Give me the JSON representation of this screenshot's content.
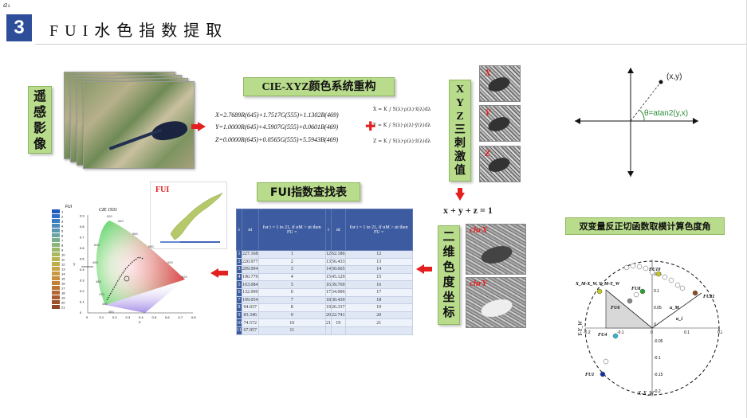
{
  "header": {
    "corner_mark": "a₁",
    "section_number": "3",
    "title": "FUI水色指数提取"
  },
  "labels": {
    "remote_sensing": [
      "遥",
      "感",
      "影",
      "像"
    ],
    "cie": "CIE-XYZ颜色系统重构",
    "xyz": [
      "X",
      "Y",
      "Z",
      "三",
      "刺",
      "激",
      "值"
    ],
    "fui_table": "FUI指数查找表",
    "chroma": [
      "二",
      "维",
      "色",
      "度",
      "坐",
      "标"
    ],
    "atan": "双变量反正切函数取模计算色度角"
  },
  "formulas": [
    "X=2.7689R(645)+1.7517G(555)+1.1302B(469)",
    "Y=1.0000R(645)+4.5907G(555)+0.0601B(469)",
    "Z=0.0000R(645)+0.0565G(555)+5.5943B(469)"
  ],
  "integrals": [
    "X = K ∫ S(λ)·ρ(λ)·x̄(λ)dλ",
    "Y = K ∫ S(λ)·ρ(λ)·ȳ(λ)dλ",
    "Z = K ∫ S(λ)·ρ(λ)·z̄(λ)dλ"
  ],
  "xyz_tags": [
    "X",
    "Y",
    "Z"
  ],
  "chroma_sum": "x + y + z = 1",
  "chroma_tags": [
    "chrX",
    "chrY"
  ],
  "fui_panel_tag": "FUI",
  "lut": {
    "headers": [
      "i",
      "αi",
      "for i = 1 to 21, if αM > αi then FU =",
      "i",
      "αi",
      "for i = 1 to 21, if αM > αi then FU ="
    ],
    "rows": [
      [
        "1",
        "227.168",
        "1",
        "12",
        "62.186",
        "12"
      ],
      [
        "2",
        "220.977",
        "2",
        "13",
        "56.433",
        "13"
      ],
      [
        "3",
        "209.994",
        "3",
        "14",
        "50.665",
        "14"
      ],
      [
        "4",
        "190.779",
        "4",
        "15",
        "45.129",
        "15"
      ],
      [
        "5",
        "163.084",
        "5",
        "16",
        "39.769",
        "16"
      ],
      [
        "6",
        "132.999",
        "6",
        "17",
        "34.906",
        "17"
      ],
      [
        "7",
        "109.054",
        "7",
        "18",
        "30.439",
        "18"
      ],
      [
        "8",
        "94.037",
        "8",
        "19",
        "26.337",
        "19"
      ],
      [
        "9",
        "83.346",
        "9",
        "20",
        "22.741",
        "20"
      ],
      [
        "10",
        "74.572",
        "10",
        "21",
        "19",
        "21"
      ],
      [
        "11",
        "67.957",
        "11",
        "",
        "",
        ""
      ]
    ]
  },
  "cie": {
    "title": "CIE 1931",
    "legend_title": "FUI",
    "fui_colors": [
      "#2158bc",
      "#316dc5",
      "#3b7bc1",
      "#4a8aba",
      "#5a98b0",
      "#6aa5a0",
      "#7aae8c",
      "#8ab47a",
      "#9ab86a",
      "#a8b85c",
      "#b4b452",
      "#bdae4c",
      "#c4a546",
      "#c69a42",
      "#c68e3e",
      "#c2813a",
      "#bc7436",
      "#b36732",
      "#a85b2e",
      "#9c512b",
      "#8e4828"
    ],
    "legend_labels": [
      "1",
      "2",
      "3",
      "4",
      "5",
      "6",
      "7",
      "8",
      "9",
      "10",
      "11",
      "12",
      "13",
      "14",
      "15",
      "16",
      "17",
      "18",
      "19",
      "20",
      "21"
    ],
    "x_ticks": [
      "0",
      "0.1",
      "0.2",
      "0.3",
      "0.4",
      "0.5",
      "0.6",
      "0.7",
      "0.8"
    ],
    "y_ticks": [
      "0",
      "0.1",
      "0.2",
      "0.3",
      "0.4",
      "0.5",
      "0.6",
      "0.7",
      "0.8",
      "0.9"
    ],
    "wavelength_labels": [
      "520",
      "540",
      "560",
      "580",
      "600",
      "620",
      "500",
      "490",
      "480",
      "470",
      "460",
      "380"
    ],
    "xlabel": "x",
    "ylabel": "y"
  },
  "polar": {
    "point_label": "(x,y)",
    "angle_label": "θ=atan2(y,x)"
  },
  "hue": {
    "x_ticks": [
      "-0.2",
      "-0.1",
      "0",
      "0.1",
      "0.2"
    ],
    "y_ticks": [
      "0.15",
      "0.1",
      "0.05",
      "0",
      "-0.05",
      "-0.1",
      "-0.15",
      "-0.2"
    ],
    "xlabel": "X-X_W",
    "ylabel": "Y-Y_W",
    "annotations": [
      "FU10",
      "FU21",
      "FU8",
      "FU6",
      "FU4",
      "FU1",
      "X_M-X_W, Y_M-Y_W",
      "α_M",
      "α_i"
    ],
    "point_colors": {
      "fu1": "#1530a8",
      "fu4": "#2ab8d8",
      "fu6": "#888888",
      "fu8": "#2aa030",
      "fu10": "#c6c822",
      "fu21": "#8a4a20",
      "white": "#ffffff"
    }
  }
}
